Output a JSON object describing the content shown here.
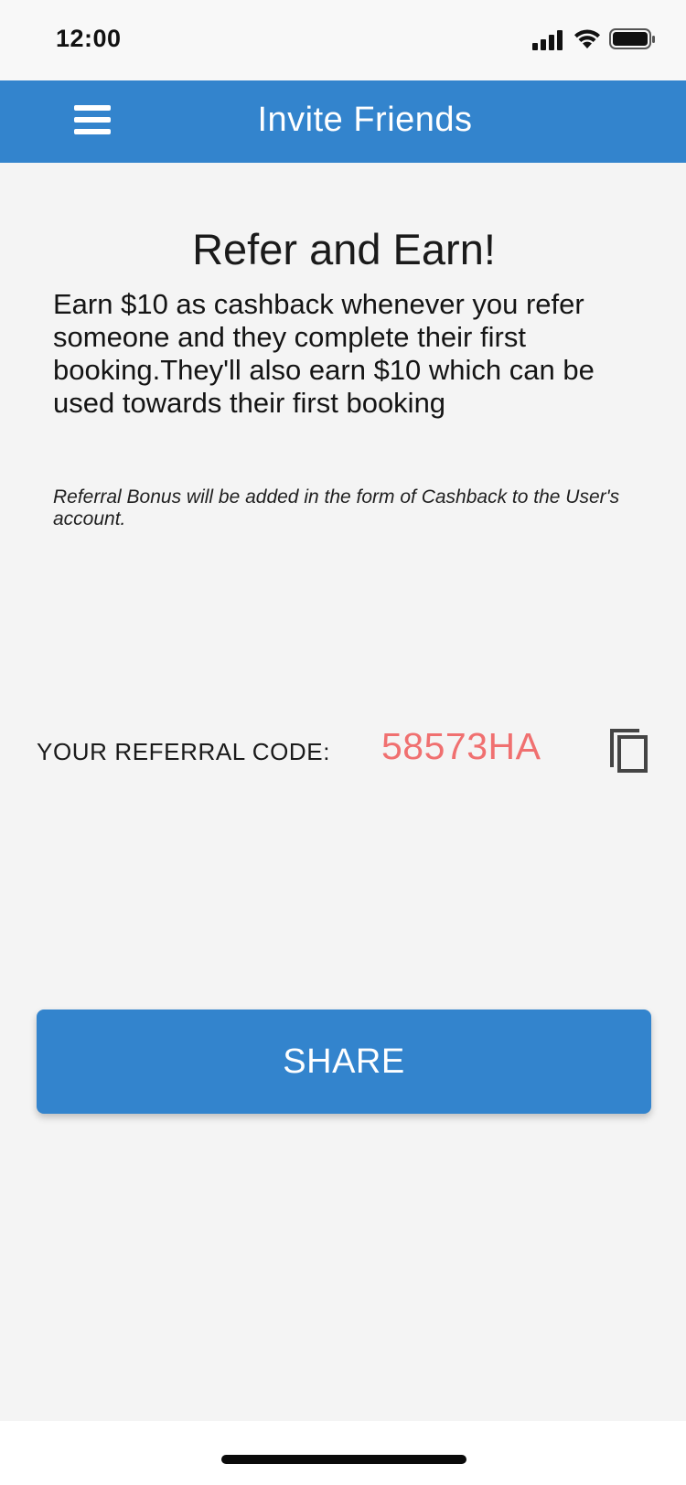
{
  "status_bar": {
    "time": "12:00",
    "icons": [
      "signal-icon",
      "wifi-icon",
      "battery-icon"
    ]
  },
  "app_bar": {
    "title": "Invite Friends",
    "menu_icon": "menu-icon",
    "color": "#3384cd"
  },
  "main": {
    "headline": "Refer and Earn!",
    "description": "Earn $10 as cashback whenever you refer someone and they complete their first booking.They'll also earn $10 which can be used towards their first booking",
    "note": "Referral Bonus will be added in the form of Cashback to the User's account."
  },
  "referral": {
    "label": "YOUR REFERRAL CODE:",
    "code": "58573HA",
    "code_color": "#f07070",
    "copy_icon": "copy-icon"
  },
  "share_button": {
    "label": "SHARE",
    "color": "#3384cd"
  }
}
